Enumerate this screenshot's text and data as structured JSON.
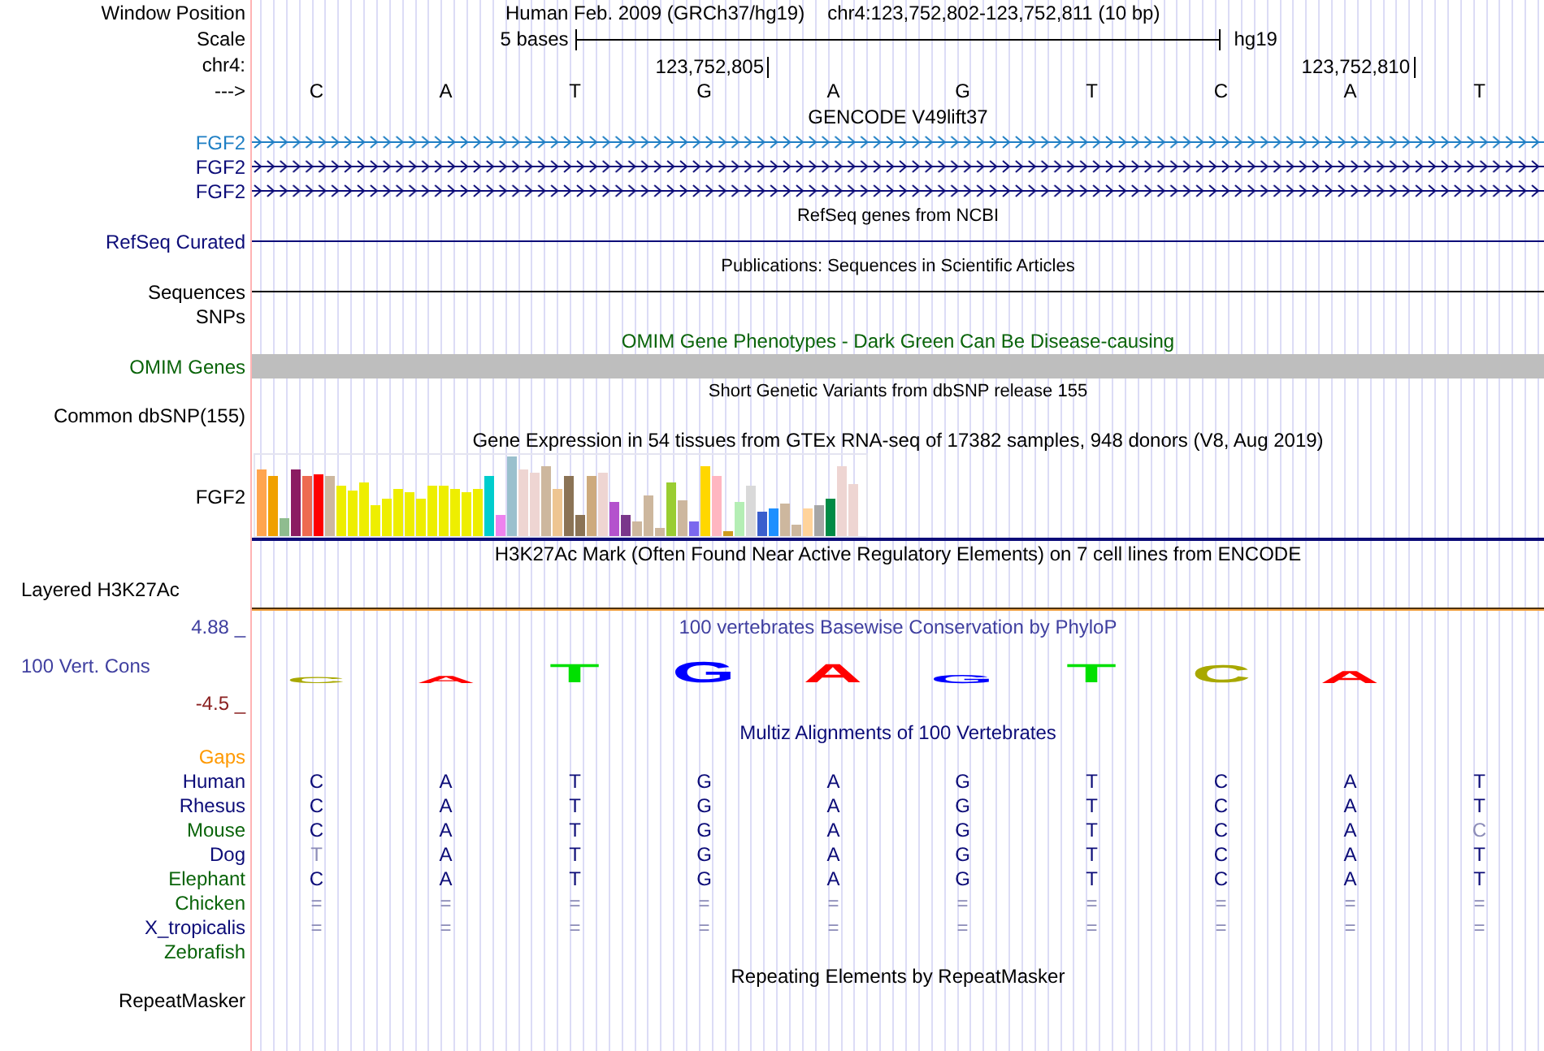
{
  "position": {
    "label": "Window Position",
    "assembly": "Human Feb. 2009 (GRCh37/hg19)",
    "range": "chr4:123,752,802-123,752,811 (10 bp)"
  },
  "scale": {
    "label": "Scale",
    "text": "5 bases",
    "db": "hg19"
  },
  "chromosome": {
    "label": "chr4:",
    "ticks": [
      "123,752,805",
      "123,752,810"
    ]
  },
  "sequence": {
    "label": "--->",
    "bases": [
      "C",
      "A",
      "T",
      "G",
      "A",
      "G",
      "T",
      "C",
      "A",
      "T"
    ]
  },
  "gencode": {
    "title": "GENCODE V49lift37",
    "genes": [
      {
        "name": "FGF2",
        "color": "#1f7fc4"
      },
      {
        "name": "FGF2",
        "color": "#0c0c78"
      },
      {
        "name": "FGF2",
        "color": "#0c0c78"
      }
    ]
  },
  "refseq": {
    "title": "RefSeq genes from NCBI",
    "label": "RefSeq Curated"
  },
  "publications": {
    "title": "Publications: Sequences in Scientific Articles",
    "label": "Sequences"
  },
  "snps": {
    "label": "SNPs"
  },
  "omim": {
    "title": "OMIM Gene Phenotypes - Dark Green Can Be Disease-causing",
    "label": "OMIM Genes"
  },
  "dbsnp": {
    "title": "Short Genetic Variants from dbSNP release 155",
    "label": "Common dbSNP(155)"
  },
  "gtex": {
    "title": "Gene Expression in 54 tissues from GTEx RNA-seq of 17382 samples, 948 donors (V8, Aug 2019)",
    "label": "FGF2"
  },
  "h3k27ac": {
    "title": "H3K27Ac Mark (Often Found Near Active Regulatory Elements) on 7 cell lines from ENCODE",
    "label": "Layered H3K27Ac"
  },
  "conservation": {
    "title": "100 vertebrates Basewise Conservation by PhyloP",
    "label": "100 Vert. Cons",
    "max": "4.88 _",
    "min": "-4.5 _",
    "letters": [
      {
        "base": "C",
        "color": "#a8a800"
      },
      {
        "base": "A",
        "color": "#ff0000"
      },
      {
        "base": "T",
        "color": "#00e000"
      },
      {
        "base": "G",
        "color": "#0000ff"
      },
      {
        "base": "A",
        "color": "#ff0000"
      },
      {
        "base": "G",
        "color": "#0000ff"
      },
      {
        "base": "T",
        "color": "#00e000"
      },
      {
        "base": "C",
        "color": "#a8a800"
      },
      {
        "base": "A",
        "color": "#ff0000"
      }
    ]
  },
  "multiz": {
    "title": "Multiz Alignments of 100 Vertebrates",
    "gaps_label": "Gaps",
    "species": [
      {
        "name": "Human",
        "color": "#0c0c78",
        "bases": [
          {
            "base": "C",
            "faint": false
          },
          {
            "base": "A",
            "faint": false
          },
          {
            "base": "T",
            "faint": false
          },
          {
            "base": "G",
            "faint": false
          },
          {
            "base": "A",
            "faint": false
          },
          {
            "base": "G",
            "faint": false
          },
          {
            "base": "T",
            "faint": false
          },
          {
            "base": "C",
            "faint": false
          },
          {
            "base": "A",
            "faint": false
          },
          {
            "base": "T",
            "faint": false
          }
        ]
      },
      {
        "name": "Rhesus",
        "color": "#0c0c78",
        "bases": [
          {
            "base": "C",
            "faint": false
          },
          {
            "base": "A",
            "faint": false
          },
          {
            "base": "T",
            "faint": false
          },
          {
            "base": "G",
            "faint": false
          },
          {
            "base": "A",
            "faint": false
          },
          {
            "base": "G",
            "faint": false
          },
          {
            "base": "T",
            "faint": false
          },
          {
            "base": "C",
            "faint": false
          },
          {
            "base": "A",
            "faint": false
          },
          {
            "base": "T",
            "faint": false
          }
        ]
      },
      {
        "name": "Mouse",
        "color": "#0a640a",
        "bases": [
          {
            "base": "C",
            "faint": false
          },
          {
            "base": "A",
            "faint": false
          },
          {
            "base": "T",
            "faint": false
          },
          {
            "base": "G",
            "faint": false
          },
          {
            "base": "A",
            "faint": false
          },
          {
            "base": "G",
            "faint": false
          },
          {
            "base": "T",
            "faint": false
          },
          {
            "base": "C",
            "faint": false
          },
          {
            "base": "A",
            "faint": false
          },
          {
            "base": "C",
            "faint": true
          }
        ]
      },
      {
        "name": "Dog",
        "color": "#0c0c78",
        "bases": [
          {
            "base": "T",
            "faint": true
          },
          {
            "base": "A",
            "faint": false
          },
          {
            "base": "T",
            "faint": false
          },
          {
            "base": "G",
            "faint": false
          },
          {
            "base": "A",
            "faint": false
          },
          {
            "base": "G",
            "faint": false
          },
          {
            "base": "T",
            "faint": false
          },
          {
            "base": "C",
            "faint": false
          },
          {
            "base": "A",
            "faint": false
          },
          {
            "base": "T",
            "faint": false
          }
        ]
      },
      {
        "name": "Elephant",
        "color": "#0a640a",
        "bases": [
          {
            "base": "C",
            "faint": false
          },
          {
            "base": "A",
            "faint": false
          },
          {
            "base": "T",
            "faint": false
          },
          {
            "base": "G",
            "faint": false
          },
          {
            "base": "A",
            "faint": false
          },
          {
            "base": "G",
            "faint": false
          },
          {
            "base": "T",
            "faint": false
          },
          {
            "base": "C",
            "faint": false
          },
          {
            "base": "A",
            "faint": false
          },
          {
            "base": "T",
            "faint": false
          }
        ]
      },
      {
        "name": "Chicken",
        "color": "#0a640a",
        "bases": [
          {
            "base": "=",
            "faint": true
          },
          {
            "base": "=",
            "faint": true
          },
          {
            "base": "=",
            "faint": true
          },
          {
            "base": "=",
            "faint": true
          },
          {
            "base": "=",
            "faint": true
          },
          {
            "base": "=",
            "faint": true
          },
          {
            "base": "=",
            "faint": true
          },
          {
            "base": "=",
            "faint": true
          },
          {
            "base": "=",
            "faint": true
          },
          {
            "base": "=",
            "faint": true
          }
        ]
      },
      {
        "name": "X_tropicalis",
        "color": "#0c0c78",
        "bases": [
          {
            "base": "=",
            "faint": true
          },
          {
            "base": "=",
            "faint": true
          },
          {
            "base": "=",
            "faint": true
          },
          {
            "base": "=",
            "faint": true
          },
          {
            "base": "=",
            "faint": true
          },
          {
            "base": "=",
            "faint": true
          },
          {
            "base": "=",
            "faint": true
          },
          {
            "base": "=",
            "faint": true
          },
          {
            "base": "=",
            "faint": true
          },
          {
            "base": "=",
            "faint": true
          }
        ]
      },
      {
        "name": "Zebrafish",
        "color": "#0a640a"
      }
    ]
  },
  "repeatmasker": {
    "title": "Repeating Elements by RepeatMasker",
    "label": "RepeatMasker"
  }
}
